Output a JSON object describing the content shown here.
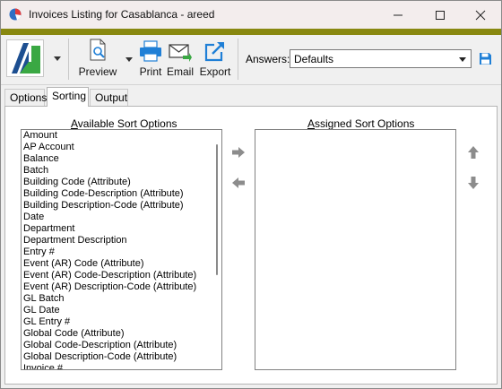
{
  "window": {
    "title": "Invoices Listing for Casablanca - areed"
  },
  "toolbar": {
    "preview_label": "Preview",
    "print_label": "Print",
    "email_label": "Email",
    "export_label": "Export",
    "answers_label": "Answers:",
    "answers_value": "Defaults"
  },
  "tabs": [
    {
      "label": "Options"
    },
    {
      "label": "Sorting"
    },
    {
      "label": "Output"
    }
  ],
  "sorting": {
    "available_label_first": "A",
    "available_label_rest": "vailable Sort Options",
    "assigned_label_first": "A",
    "assigned_label_rest": "ssigned Sort Options",
    "available_items": [
      "Amount",
      "AP Account",
      "Balance",
      "Batch",
      "Building Code (Attribute)",
      "Building Code-Description (Attribute)",
      "Building Description-Code (Attribute)",
      "Date",
      "Department",
      "Department Description",
      "Entry #",
      "Event (AR) Code (Attribute)",
      "Event (AR) Code-Description (Attribute)",
      "Event (AR) Description-Code (Attribute)",
      "GL Batch",
      "GL Date",
      "GL Entry #",
      "Global Code (Attribute)",
      "Global Code-Description (Attribute)",
      "Global Description-Code (Attribute)",
      "Invoice #"
    ],
    "assigned_items": []
  },
  "colors": {
    "accent_band": "#888810",
    "icon_blue": "#1f7fd6",
    "logo_blue": "#1d4f91",
    "logo_green": "#3aa843"
  }
}
